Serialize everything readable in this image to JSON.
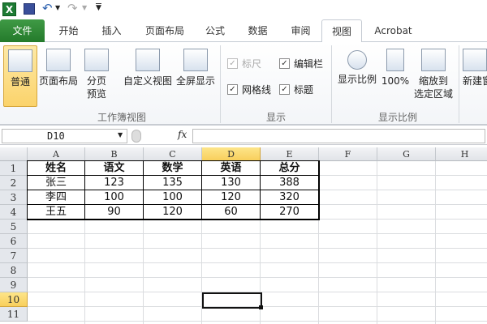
{
  "qat": {
    "app_icon": "excel-icon",
    "items": [
      "save-icon",
      "undo-icon",
      "redo-icon",
      "customize-icon"
    ]
  },
  "tabs": [
    {
      "label": "文件"
    },
    {
      "label": "开始"
    },
    {
      "label": "插入"
    },
    {
      "label": "页面布局"
    },
    {
      "label": "公式"
    },
    {
      "label": "数据"
    },
    {
      "label": "审阅"
    },
    {
      "label": "视图"
    },
    {
      "label": "Acrobat"
    }
  ],
  "active_tab": "视图",
  "ribbon": {
    "workbook_views": {
      "label": "工作簿视图",
      "buttons": [
        "普通",
        "页面布局",
        "分页\n预览",
        "自定义视图",
        "全屏显示"
      ],
      "split_preview": [
        "分页",
        "预览"
      ]
    },
    "show": {
      "label": "显示",
      "checks": [
        {
          "label": "标尺",
          "checked": true,
          "disabled": true
        },
        {
          "label": "编辑栏",
          "checked": true
        },
        {
          "label": "网格线",
          "checked": true
        },
        {
          "label": "标题",
          "checked": true
        }
      ]
    },
    "zoom": {
      "label": "显示比例",
      "buttons": [
        "显示比例",
        "100%"
      ],
      "zoom_sel": [
        "缩放到",
        "选定区域"
      ]
    },
    "window": {
      "new_window": "新建窗"
    }
  },
  "formula_bar": {
    "name_box": "D10",
    "fx": "fx",
    "value": ""
  },
  "columns": [
    "A",
    "B",
    "C",
    "D",
    "E",
    "F",
    "G",
    "H"
  ],
  "rows": [
    "1",
    "2",
    "3",
    "4",
    "5",
    "6",
    "7",
    "8",
    "9",
    "10",
    "11"
  ],
  "table": {
    "header": [
      "姓名",
      "语文",
      "数学",
      "英语",
      "总分"
    ],
    "rows": [
      [
        "张三",
        "123",
        "135",
        "130",
        "388"
      ],
      [
        "李四",
        "100",
        "100",
        "120",
        "320"
      ],
      [
        "王五",
        "90",
        "120",
        "60",
        "270"
      ]
    ]
  },
  "selected_cell": "D10"
}
